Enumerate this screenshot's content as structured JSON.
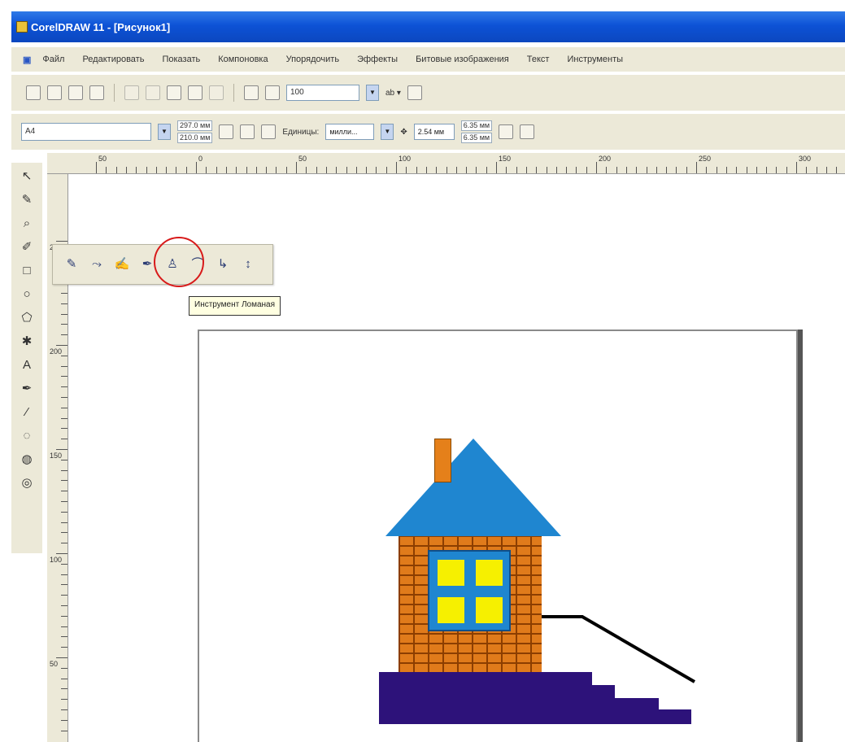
{
  "window": {
    "title": "CorelDRAW 11 - [Рисунок1]"
  },
  "menu": {
    "items": [
      "Файл",
      "Редактировать",
      "Показать",
      "Компоновка",
      "Упорядочить",
      "Эффекты",
      "Битовые изображения",
      "Текст",
      "Инструменты"
    ]
  },
  "toolbar": {
    "zoom_value": "100",
    "zoom_unit_label": "ab ▾"
  },
  "property_bar": {
    "page_size": "A4",
    "width_value": "297.0 мм",
    "height_value": "210.0 мм",
    "units_label": "Единицы:",
    "units_value": "милли...",
    "nudge_value": "2.54 мм",
    "duplicate_h": "6.35 мм",
    "duplicate_v": "6.35 мм"
  },
  "ruler": {
    "h_labels": [
      "50",
      "0",
      "50",
      "100",
      "150",
      "200",
      "250",
      "300"
    ],
    "v_labels": [
      "250",
      "200",
      "150",
      "100",
      "50"
    ]
  },
  "flyout": {
    "tooltip": "Инструмент Ломаная"
  },
  "colors": {
    "roof": "#1f86d0",
    "walls": "#e07b1b",
    "window_glass": "#f6f000",
    "foundation": "#2d127a",
    "highlight": "#d81a1a",
    "titlebar": "#0d52d6"
  },
  "icons": {
    "toolbox": [
      "pick-tool-icon",
      "shape-tool-icon",
      "zoom-tool-icon",
      "freehand-tool-icon",
      "rectangle-tool-icon",
      "ellipse-tool-icon",
      "polygon-tool-icon",
      "spiral-tool-icon",
      "text-tool-icon",
      "interactive-fill-icon",
      "eyedropper-icon",
      "outline-icon",
      "fill-icon",
      "interactive-tool-icon"
    ],
    "flyout": [
      "freehand-icon",
      "bezier-icon",
      "artistic-media-icon",
      "pen-icon",
      "polyline-icon",
      "3-point-curve-icon",
      "interactive-connector-icon",
      "dimension-icon"
    ]
  }
}
